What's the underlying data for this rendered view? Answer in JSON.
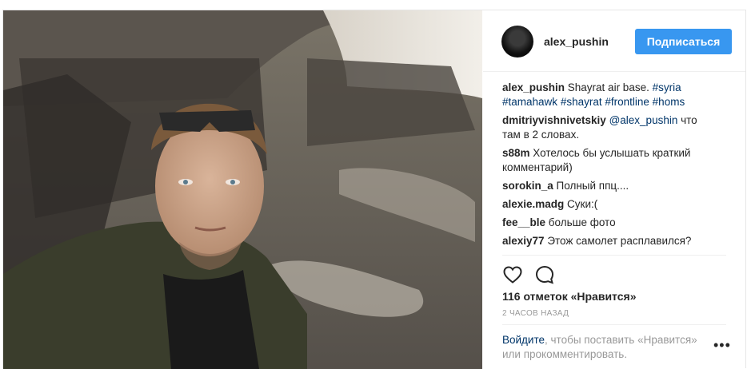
{
  "post": {
    "author": "alex_pushin",
    "follow_label": "Подписаться"
  },
  "comments": [
    {
      "user": "alex_pushin",
      "text": " Shayrat air base. ",
      "tags": [
        "#syria",
        "#tamahawk",
        "#shayrat",
        "#frontline",
        "#homs"
      ]
    },
    {
      "user": "dmitriyvishnivetskiy",
      "mention": "@alex_pushin",
      "text": " что там в 2 словах."
    },
    {
      "user": "s88m",
      "text": " Хотелось бы услышать краткий комментарий)"
    },
    {
      "user": "sorokin_a",
      "text": " Полный ппц...."
    },
    {
      "user": "alexie.madg",
      "text": " Суки:("
    },
    {
      "user": "fee__ble",
      "text": " больше фото"
    },
    {
      "user": "alexiy77",
      "text": " Этож самолет расплавился?"
    }
  ],
  "likes_text": "116 отметок «Нравится»",
  "time_text": "2 часов назад",
  "login": {
    "link": "Войдите",
    "rest": ", чтобы поставить «Нравится» или прокомментировать."
  },
  "more_label": "•••",
  "icons": {
    "like": "heart-icon",
    "comment": "speech-bubble-icon",
    "more": "more-dots-icon"
  },
  "colors": {
    "accent": "#3897f0",
    "link": "#003569",
    "muted": "#999999"
  }
}
